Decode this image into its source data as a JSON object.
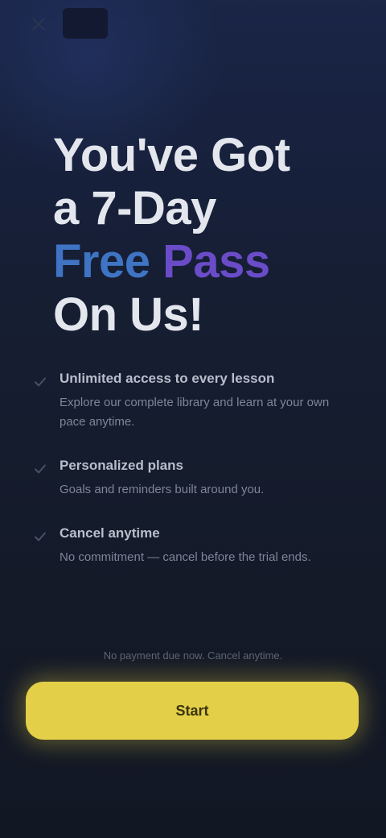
{
  "nav": {
    "close_icon": "close-icon",
    "logo_label": ""
  },
  "hero": {
    "line1": "You've Got",
    "line2": "a 7-Day",
    "line3_part1": "Free",
    "line3_part2": "Pass",
    "line4": "On Us!"
  },
  "features": [
    {
      "icon": "check-icon",
      "title": "Unlimited access to every lesson",
      "desc": "Explore our complete library and learn at your own pace anytime."
    },
    {
      "icon": "check-icon",
      "title": "Personalized plans",
      "desc": "Goals and reminders built around you."
    },
    {
      "icon": "check-icon",
      "title": "Cancel anytime",
      "desc": "No commitment — cancel before the trial ends."
    }
  ],
  "footnote": "No payment due now. Cancel anytime.",
  "cta": {
    "label": "Start"
  },
  "colors": {
    "accent_yellow": "#e3cf48",
    "accent_blue": "#3f74c4",
    "accent_purple": "#6a4cc8",
    "background": "#151b2a"
  }
}
